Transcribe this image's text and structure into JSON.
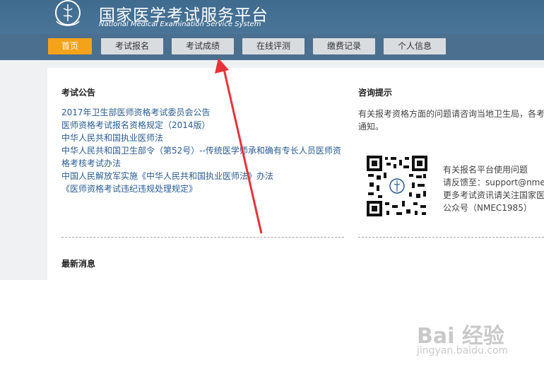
{
  "header": {
    "title_cn": "国家医学考试服务平台",
    "title_en": "National Medical Examination Service System"
  },
  "nav": [
    {
      "label": "首页"
    },
    {
      "label": "考试报名"
    },
    {
      "label": "考试成绩"
    },
    {
      "label": "在线评测"
    },
    {
      "label": "缴费记录"
    },
    {
      "label": "个人信息"
    }
  ],
  "notice": {
    "title": "考试公告",
    "links": [
      "2017年卫生部医师资格考试委员会公告",
      "医师资格考试报名资格规定（2014版）",
      "中华人民共和国执业医师法",
      "中华人民共和国卫生部令（第52号）--传统医学师承和确有专长人员医师资格考核考试办法",
      "中国人民解放军实施《中华人民共和国执业医师法》办法",
      "《医师资格考试违纪违规处理规定》"
    ]
  },
  "tips": {
    "title": "咨询提示",
    "line1": "有关报考资格方面的问题请咨询当地卫生局，各考",
    "line2": "通知。",
    "qr_info": [
      "有关报名平台使用问题",
      "请反馈至：support@nmec",
      "更多考试资讯请关注国家医",
      "公众号（NMEC1985）"
    ]
  },
  "news": {
    "title": "最新消息"
  },
  "watermark": {
    "main": "Bai 经验",
    "sub": "jingyan.baidu.com"
  },
  "colors": {
    "header": "#3f6b8f",
    "nav": "#4b6f8f",
    "active": "#f5a21b",
    "link": "#2a5d93",
    "arrow": "#e8323a"
  }
}
